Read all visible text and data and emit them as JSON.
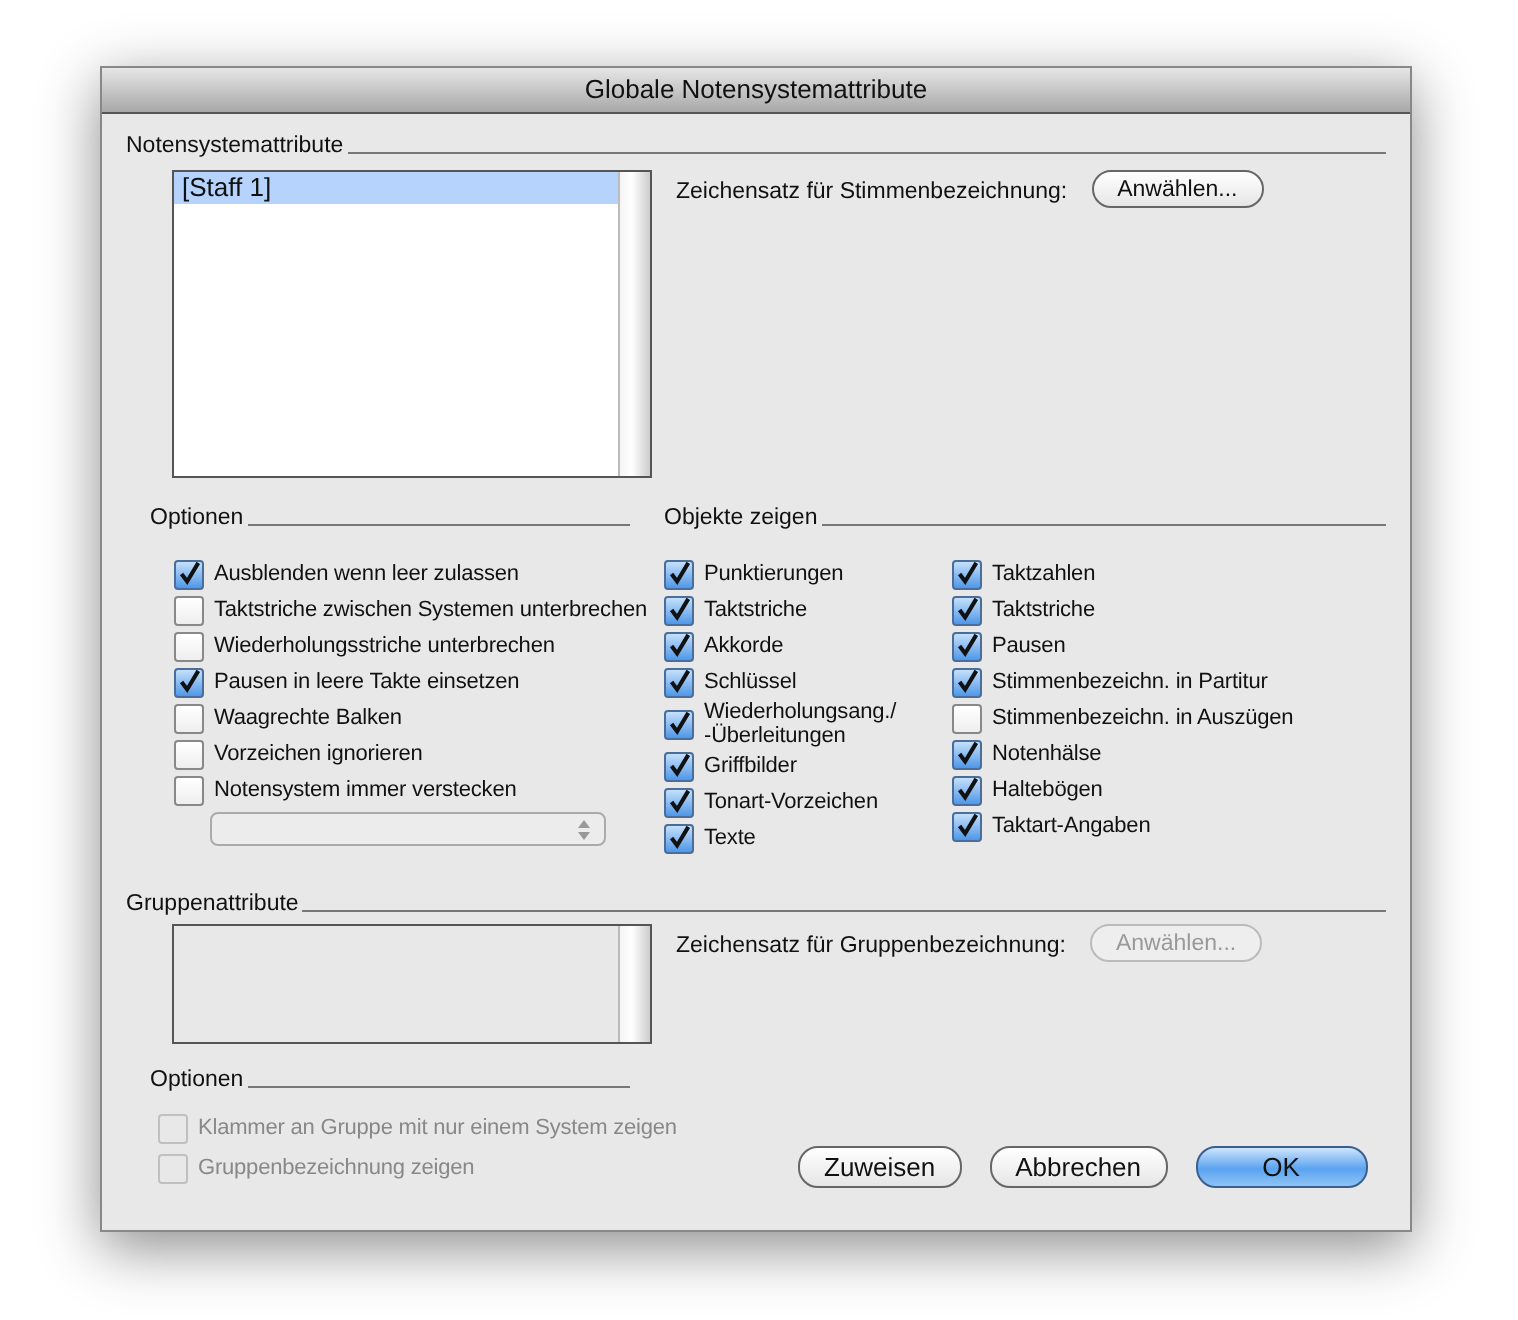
{
  "window": {
    "title": "Globale Notensystemattribute"
  },
  "staff_section": {
    "heading": "Notensystemattribute",
    "list": [
      {
        "label": "[Staff 1]",
        "selected": true
      }
    ],
    "font_label": "Zeichensatz für Stimmenbezeichnung:",
    "font_button": {
      "label": "Anwählen...",
      "disabled": false
    }
  },
  "options": {
    "heading": "Optionen",
    "items": [
      {
        "label": "Ausblenden wenn leer zulassen",
        "checked": true
      },
      {
        "label": "Taktstriche zwischen Systemen unterbrechen",
        "checked": false
      },
      {
        "label": "Wiederholungsstriche unterbrechen",
        "checked": false
      },
      {
        "label": "Pausen in leere Takte einsetzen",
        "checked": true
      },
      {
        "label": "Waagrechte Balken",
        "checked": false
      },
      {
        "label": "Vorzeichen ignorieren",
        "checked": false
      },
      {
        "label": "Notensystem immer verstecken",
        "checked": false
      }
    ],
    "dropdown": {
      "disabled": true
    }
  },
  "show_objects": {
    "heading": "Objekte zeigen",
    "columns": [
      {
        "items": [
          {
            "label": "Punktierungen",
            "checked": true
          },
          {
            "label": "Taktstriche",
            "checked": true
          },
          {
            "label": "Akkorde",
            "checked": true
          },
          {
            "label": "Schlüssel",
            "checked": true
          },
          {
            "label": "Wiederholungsang./\n-Überleitungen",
            "checked": true
          },
          {
            "label": "Griffbilder",
            "checked": true
          },
          {
            "label": "Tonart-Vorzeichen",
            "checked": true
          },
          {
            "label": "Texte",
            "checked": true
          }
        ]
      },
      {
        "items": [
          {
            "label": "Taktzahlen",
            "checked": true
          },
          {
            "label": "Taktstriche",
            "checked": true
          },
          {
            "label": "Pausen",
            "checked": true
          },
          {
            "label": "Stimmenbezeichn. in Partitur",
            "checked": true
          },
          {
            "label": "Stimmenbezeichn. in Auszügen",
            "checked": false
          },
          {
            "label": "Notenhälse",
            "checked": true
          },
          {
            "label": "Haltebögen",
            "checked": true
          },
          {
            "label": "Taktart-Angaben",
            "checked": true
          }
        ]
      }
    ]
  },
  "group_section": {
    "heading": "Gruppenattribute",
    "font_label": "Zeichensatz für Gruppenbezeichnung:",
    "font_button": {
      "label": "Anwählen...",
      "disabled": true
    },
    "options_heading": "Optionen",
    "items": [
      {
        "label": "Klammer an Gruppe mit nur einem System zeigen",
        "checked": false,
        "disabled": true
      },
      {
        "label": "Gruppenbezeichnung zeigen",
        "checked": false,
        "disabled": true
      }
    ]
  },
  "buttons": [
    {
      "label": "Zuweisen",
      "default": false
    },
    {
      "label": "Abbrechen",
      "default": false
    },
    {
      "label": "OK",
      "default": true
    }
  ]
}
